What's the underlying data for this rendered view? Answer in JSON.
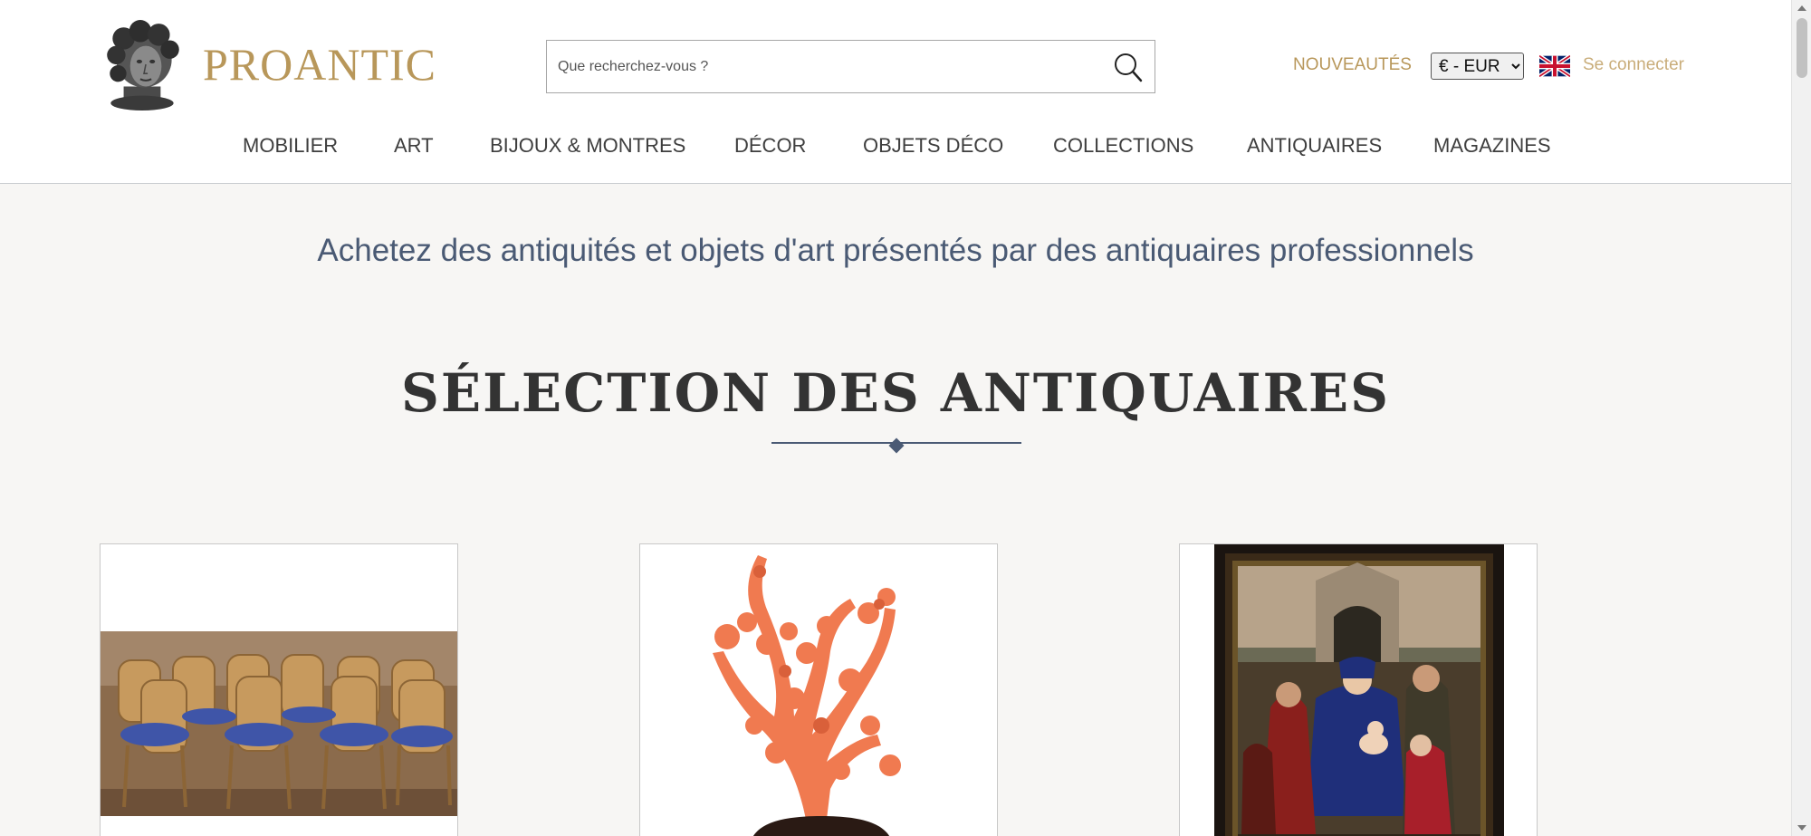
{
  "brand": {
    "name": "PROANTIC"
  },
  "search": {
    "placeholder": "Que recherchez-vous ?"
  },
  "topbar": {
    "nouveautes": "NOUVEAUTÉS",
    "currency_selected": "€ - EUR",
    "language_flag": "uk-flag-icon",
    "login": "Se connecter"
  },
  "nav": [
    "MOBILIER",
    "ART",
    "BIJOUX & MONTRES",
    "DÉCOR",
    "OBJETS DÉCO",
    "COLLECTIONS",
    "ANTIQUAIRES",
    "MAGAZINES"
  ],
  "tagline": "Achetez des antiquités et objets d'art présentés par des antiquaires professionnels",
  "section": {
    "title": "SÉLECTION DES ANTIQUAIRES"
  },
  "colors": {
    "gold": "#b8975a",
    "navy": "#4a5a74",
    "background": "#f7f6f4"
  }
}
